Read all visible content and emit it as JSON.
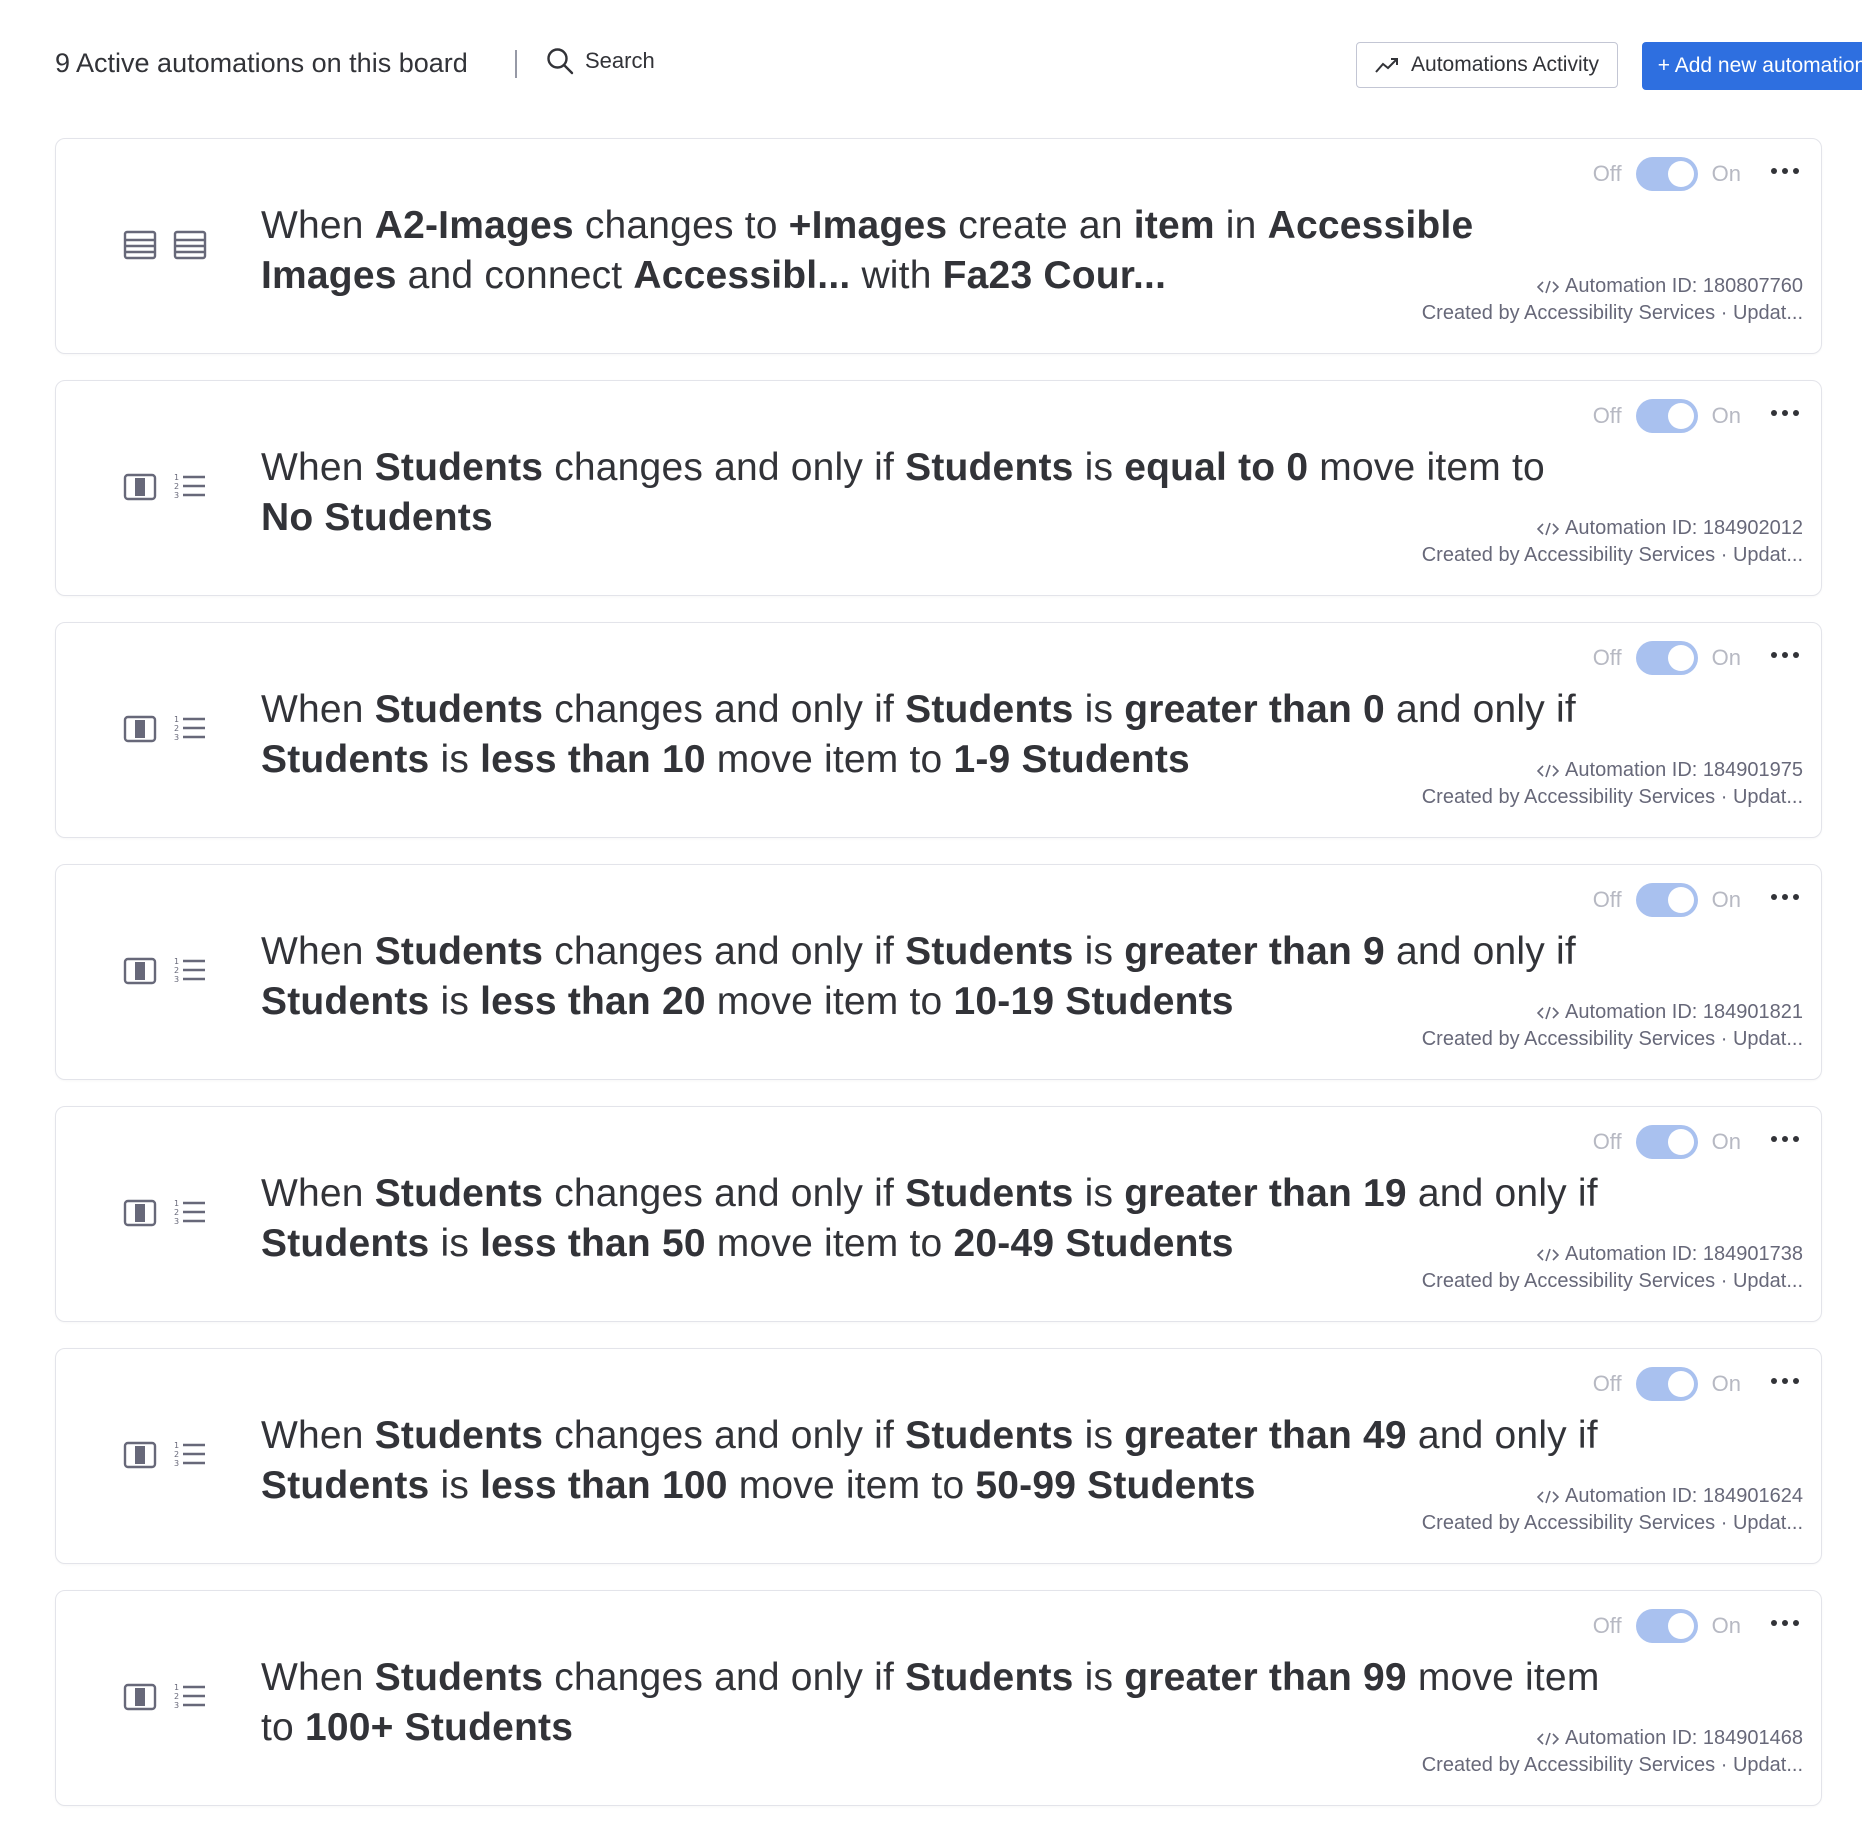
{
  "header": {
    "count_label": "9 Active automations on this board",
    "search_label": "Search",
    "activity_label": "Automations Activity",
    "add_label": "+ Add new automation"
  },
  "colors": {
    "accent": "#2e6fe0",
    "toggle_on": "#a9c1ef",
    "text": "#323338",
    "muted": "#676879"
  },
  "toggle": {
    "off_label": "Off",
    "on_label": "On"
  },
  "automations": [
    {
      "icons": [
        "table-icon",
        "table-icon"
      ],
      "id_label": "Automation ID: 180807760",
      "created": "Created by Accessibility Services · Updat...",
      "enabled": true,
      "parts": [
        {
          "t": "When ",
          "b": false
        },
        {
          "t": "A2-Images",
          "b": true
        },
        {
          "t": " changes to ",
          "b": false
        },
        {
          "t": "+Images",
          "b": true
        },
        {
          "t": " create an ",
          "b": false
        },
        {
          "t": "item",
          "b": true
        },
        {
          "t": " in ",
          "b": false
        },
        {
          "t": "Accessible Images",
          "b": true
        },
        {
          "t": " and connect ",
          "b": false
        },
        {
          "t": "Accessibl...",
          "b": true
        },
        {
          "t": "  with ",
          "b": false
        },
        {
          "t": "Fa23 Cour...",
          "b": true
        }
      ]
    },
    {
      "icons": [
        "column-icon",
        "numbered-list-icon"
      ],
      "id_label": "Automation ID: 184902012",
      "created": "Created by Accessibility Services · Updat...",
      "enabled": true,
      "parts": [
        {
          "t": "When ",
          "b": false
        },
        {
          "t": "Students",
          "b": true
        },
        {
          "t": " changes and only if ",
          "b": false
        },
        {
          "t": "Students",
          "b": true
        },
        {
          "t": " is ",
          "b": false
        },
        {
          "t": "equal to 0",
          "b": true
        },
        {
          "t": " move item to ",
          "b": false
        },
        {
          "t": "No Students",
          "b": true
        }
      ]
    },
    {
      "icons": [
        "column-icon",
        "numbered-list-icon"
      ],
      "id_label": "Automation ID: 184901975",
      "created": "Created by Accessibility Services · Updat...",
      "enabled": true,
      "parts": [
        {
          "t": "When ",
          "b": false
        },
        {
          "t": "Students",
          "b": true
        },
        {
          "t": " changes and only if ",
          "b": false
        },
        {
          "t": "Students",
          "b": true
        },
        {
          "t": " is ",
          "b": false
        },
        {
          "t": "greater than 0",
          "b": true
        },
        {
          "t": " and only if ",
          "b": false
        },
        {
          "t": "Students",
          "b": true
        },
        {
          "t": " is ",
          "b": false
        },
        {
          "t": "less than 10",
          "b": true
        },
        {
          "t": " move item to ",
          "b": false
        },
        {
          "t": "1-9 Students",
          "b": true
        }
      ]
    },
    {
      "icons": [
        "column-icon",
        "numbered-list-icon"
      ],
      "id_label": "Automation ID: 184901821",
      "created": "Created by Accessibility Services · Updat...",
      "enabled": true,
      "parts": [
        {
          "t": "When ",
          "b": false
        },
        {
          "t": "Students",
          "b": true
        },
        {
          "t": " changes and only if ",
          "b": false
        },
        {
          "t": "Students",
          "b": true
        },
        {
          "t": " is ",
          "b": false
        },
        {
          "t": "greater than 9",
          "b": true
        },
        {
          "t": " and only if ",
          "b": false
        },
        {
          "t": "Students",
          "b": true
        },
        {
          "t": " is ",
          "b": false
        },
        {
          "t": "less than 20",
          "b": true
        },
        {
          "t": " move item to ",
          "b": false
        },
        {
          "t": "10-19 Students",
          "b": true
        }
      ]
    },
    {
      "icons": [
        "column-icon",
        "numbered-list-icon"
      ],
      "id_label": "Automation ID: 184901738",
      "created": "Created by Accessibility Services · Updat...",
      "enabled": true,
      "parts": [
        {
          "t": "When ",
          "b": false
        },
        {
          "t": "Students",
          "b": true
        },
        {
          "t": " changes and only if ",
          "b": false
        },
        {
          "t": "Students",
          "b": true
        },
        {
          "t": " is ",
          "b": false
        },
        {
          "t": "greater than 19",
          "b": true
        },
        {
          "t": " and only if ",
          "b": false
        },
        {
          "t": "Students",
          "b": true
        },
        {
          "t": " is ",
          "b": false
        },
        {
          "t": "less than 50",
          "b": true
        },
        {
          "t": " move item to ",
          "b": false
        },
        {
          "t": "20-49 Students",
          "b": true
        }
      ]
    },
    {
      "icons": [
        "column-icon",
        "numbered-list-icon"
      ],
      "id_label": "Automation ID: 184901624",
      "created": "Created by Accessibility Services · Updat...",
      "enabled": true,
      "parts": [
        {
          "t": "When ",
          "b": false
        },
        {
          "t": "Students",
          "b": true
        },
        {
          "t": " changes and only if ",
          "b": false
        },
        {
          "t": "Students",
          "b": true
        },
        {
          "t": " is ",
          "b": false
        },
        {
          "t": "greater than 49",
          "b": true
        },
        {
          "t": " and only if ",
          "b": false
        },
        {
          "t": "Students",
          "b": true
        },
        {
          "t": " is ",
          "b": false
        },
        {
          "t": "less than 100",
          "b": true
        },
        {
          "t": " move item to ",
          "b": false
        },
        {
          "t": "50-99 Students",
          "b": true
        }
      ]
    },
    {
      "icons": [
        "column-icon",
        "numbered-list-icon"
      ],
      "id_label": "Automation ID: 184901468",
      "created": "Created by Accessibility Services · Updat...",
      "enabled": true,
      "parts": [
        {
          "t": "When ",
          "b": false
        },
        {
          "t": "Students",
          "b": true
        },
        {
          "t": " changes and only if ",
          "b": false
        },
        {
          "t": "Students",
          "b": true
        },
        {
          "t": " is ",
          "b": false
        },
        {
          "t": "greater than 99",
          "b": true
        },
        {
          "t": " move item to ",
          "b": false
        },
        {
          "t": "100+ Students",
          "b": true
        }
      ]
    }
  ]
}
